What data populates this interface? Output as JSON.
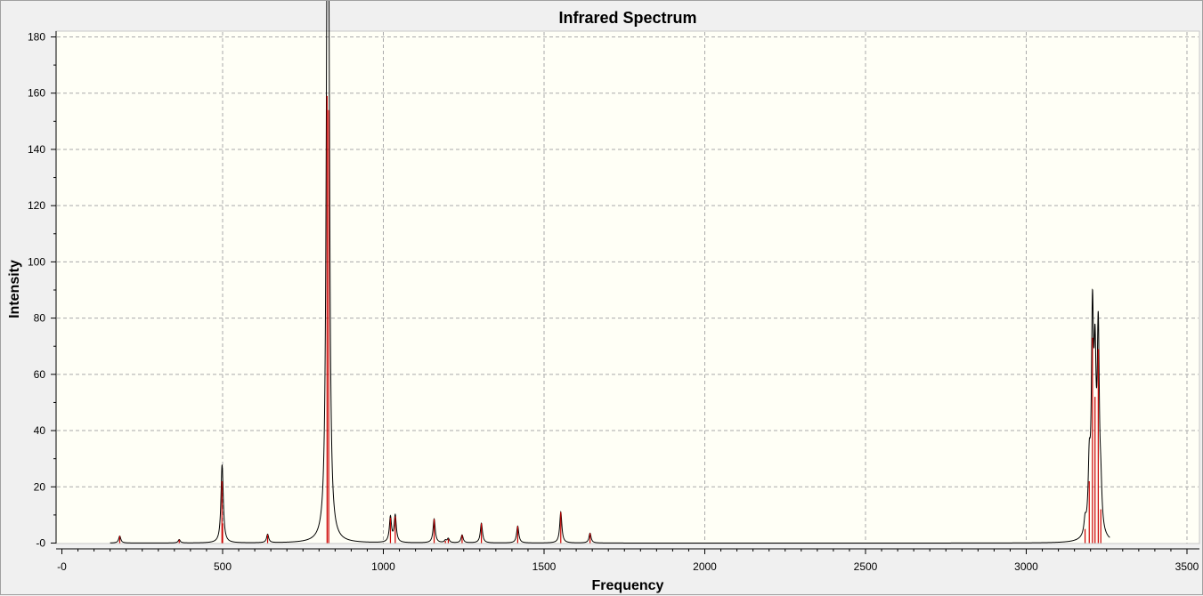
{
  "chart_data": {
    "type": "line",
    "title": "Infrared Spectrum",
    "xlabel": "Frequency",
    "ylabel": "Intensity",
    "xlim": [
      0,
      3500
    ],
    "ylim": [
      0,
      180
    ],
    "x_ticks": [
      0,
      500,
      1000,
      1500,
      2000,
      2500,
      3000,
      3500
    ],
    "x_tick_labels": [
      "-0",
      "500",
      "1000",
      "1500",
      "2000",
      "2500",
      "3000",
      "3500"
    ],
    "y_ticks": [
      0,
      20,
      40,
      60,
      80,
      100,
      120,
      140,
      160,
      180
    ],
    "y_tick_labels": [
      "-0",
      "20",
      "40",
      "60",
      "80",
      "100",
      "120",
      "140",
      "160",
      "180"
    ],
    "grid": true,
    "background_color": "#fffff6",
    "spectrum_color": "#000000",
    "stick_color": "#cc0000",
    "peak_halfwidth": 4,
    "sticks": [
      {
        "x": 180,
        "y": 2.5
      },
      {
        "x": 365,
        "y": 1.2
      },
      {
        "x": 498,
        "y": 22
      },
      {
        "x": 500,
        "y": 7
      },
      {
        "x": 640,
        "y": 3
      },
      {
        "x": 825,
        "y": 159
      },
      {
        "x": 830,
        "y": 154
      },
      {
        "x": 1022,
        "y": 9
      },
      {
        "x": 1037,
        "y": 9.5
      },
      {
        "x": 1158,
        "y": 8.5
      },
      {
        "x": 1202,
        "y": 1.5
      },
      {
        "x": 1245,
        "y": 2.8
      },
      {
        "x": 1305,
        "y": 7
      },
      {
        "x": 1418,
        "y": 6
      },
      {
        "x": 1552,
        "y": 11
      },
      {
        "x": 1643,
        "y": 3.5
      },
      {
        "x": 1193,
        "y": 0.8
      },
      {
        "x": 3183,
        "y": 5
      },
      {
        "x": 3196,
        "y": 22
      },
      {
        "x": 3206,
        "y": 73
      },
      {
        "x": 3214,
        "y": 52
      },
      {
        "x": 3224,
        "y": 69
      },
      {
        "x": 3232,
        "y": 12
      }
    ]
  }
}
